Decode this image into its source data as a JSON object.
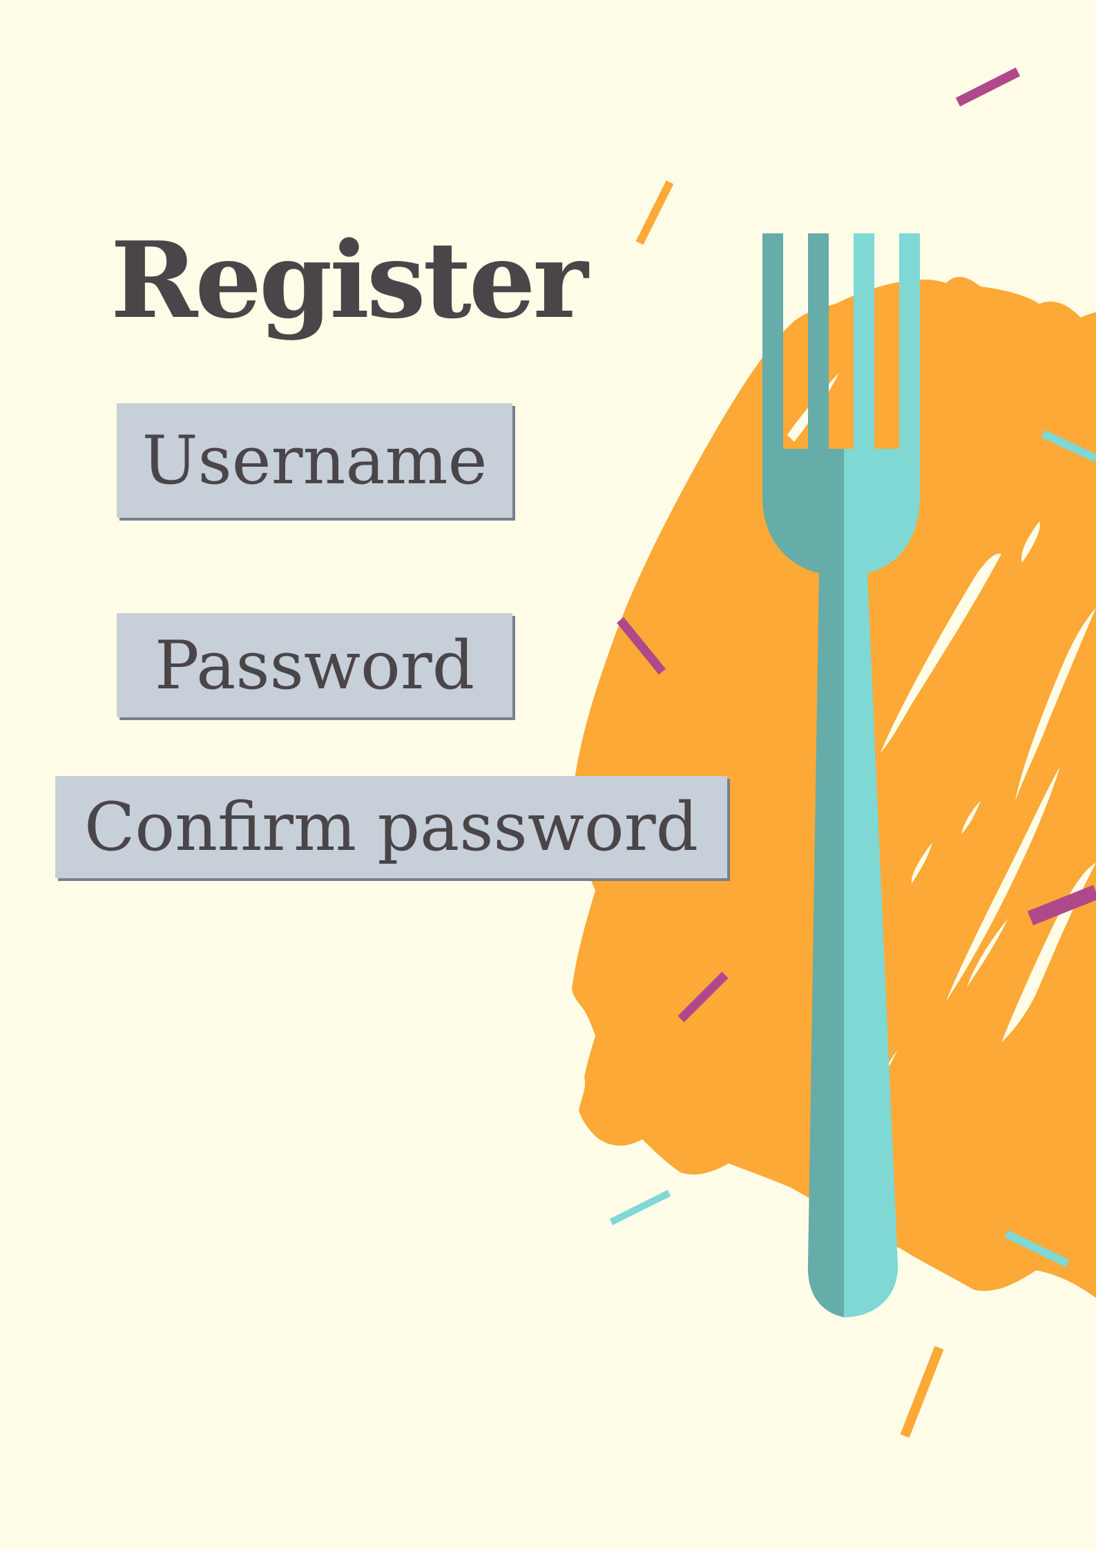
{
  "form": {
    "title": "Register",
    "username_label": "Username",
    "password_label": "Password",
    "confirm_label": "Confirm password"
  },
  "colors": {
    "background": "#fffde8",
    "text": "#4a4548",
    "field_fill": "#c7cfd8",
    "field_shadow": "#76808f",
    "splash_orange": "#fca937",
    "fork_dark": "#66aca8",
    "fork_light": "#7fd8d4",
    "accent_purple": "#b0498c",
    "accent_teal": "#7fd8d4"
  },
  "icons": [
    "fork-icon",
    "paint-splash",
    "confetti-dash"
  ]
}
